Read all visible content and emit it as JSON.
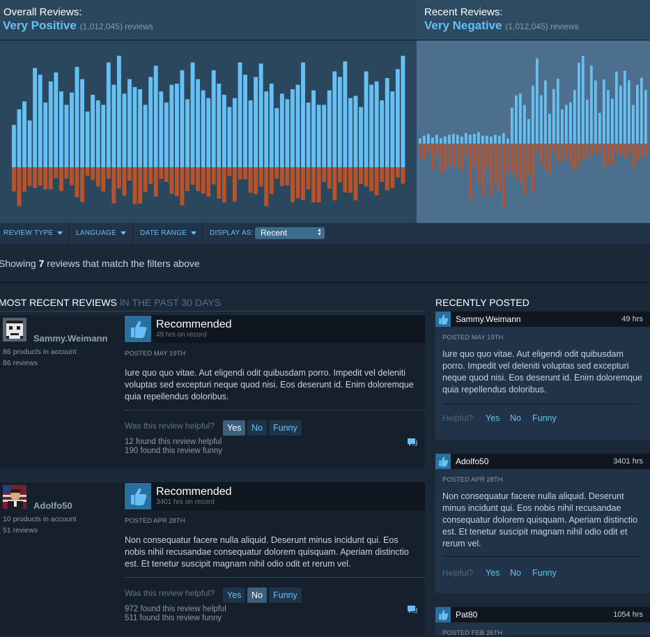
{
  "overall": {
    "label": "Overall Reviews:",
    "rating": "Very Positive",
    "count": "(1,012,045) reviews",
    "pos": [
      0.38,
      0.52,
      0.59,
      0.42,
      0.89,
      0.83,
      0.58,
      0.77,
      0.85,
      0.68,
      0.56,
      0.67,
      0.9,
      0.79,
      0.5,
      0.65,
      0.6,
      0.56,
      0.94,
      0.74,
      1.0,
      0.66,
      0.79,
      0.72,
      0.7,
      0.56,
      0.81,
      0.91,
      0.68,
      0.58,
      0.74,
      0.75,
      0.87,
      0.61,
      0.94,
      0.79,
      0.69,
      0.62,
      0.87,
      0.75,
      0.65,
      0.54,
      0.62,
      0.94,
      0.83,
      0.6,
      0.81,
      0.93,
      0.68,
      0.75,
      0.53,
      0.66,
      0.61,
      0.7,
      0.74,
      0.94,
      0.58,
      0.69,
      0.56,
      0.56,
      0.69,
      0.86,
      0.81,
      0.95,
      0.62,
      0.64,
      0.54,
      0.86,
      0.74,
      0.77,
      0.6,
      0.8,
      0.68,
      0.88,
      1.0
    ],
    "neg": [
      0.58,
      0.93,
      0.58,
      0.45,
      0.5,
      0.44,
      0.53,
      0.53,
      0.26,
      0.57,
      0.27,
      0.43,
      0.72,
      0.83,
      0.2,
      0.31,
      0.46,
      0.58,
      0.27,
      0.86,
      0.51,
      0.68,
      0.32,
      0.88,
      0.87,
      0.59,
      0.4,
      0.7,
      0.28,
      0.35,
      0.63,
      0.69,
      0.91,
      0.57,
      0.42,
      0.57,
      0.63,
      0.7,
      0.41,
      0.75,
      0.84,
      0.21,
      0.82,
      0.29,
      0.29,
      0.61,
      0.64,
      0.46,
      0.93,
      0.64,
      0.27,
      0.45,
      0.43,
      0.84,
      0.74,
      0.78,
      0.53,
      0.84,
      0.84,
      0.35,
      0.51,
      0.79,
      0.36,
      0.6,
      0.61,
      0.79,
      0.4,
      0.46,
      0.57,
      0.67,
      0.35,
      0.55,
      0.5,
      0.24,
      0.39
    ]
  },
  "recent": {
    "label": "Recent Reviews:",
    "rating": "Very Negative",
    "count": "(1,012,045) reviews",
    "pos": [
      0.06,
      0.09,
      0.11,
      0.07,
      0.1,
      0.06,
      0.08,
      0.1,
      0.11,
      0.1,
      0.08,
      0.12,
      0.1,
      0.11,
      0.13,
      0.09,
      0.09,
      0.08,
      0.1,
      0.09,
      0.12,
      0.06,
      0.41,
      0.55,
      0.57,
      0.44,
      0.28,
      0.66,
      0.97,
      0.55,
      0.72,
      0.34,
      0.62,
      0.74,
      0.39,
      0.44,
      0.47,
      0.61,
      0.92,
      1.0,
      0.5,
      0.89,
      0.72,
      0.35,
      0.73,
      0.61,
      0.51,
      0.82,
      0.66,
      0.83,
      0.72,
      0.44,
      0.67,
      0.75,
      0.61
    ],
    "neg": [
      0.23,
      0.25,
      0.15,
      0.41,
      0.19,
      0.46,
      0.41,
      0.33,
      0.37,
      0.37,
      0.43,
      0.2,
      0.88,
      0.35,
      0.63,
      0.8,
      0.4,
      0.83,
      0.65,
      0.75,
      1.0,
      0.46,
      0.46,
      0.53,
      0.61,
      0.79,
      0.48,
      0.76,
      0.14,
      0.32,
      0.43,
      0.47,
      0.14,
      0.29,
      0.27,
      0.21,
      0.34,
      0.43,
      0.34,
      0.25,
      0.22,
      0.16,
      0.19,
      0.14,
      0.36,
      0.33,
      0.35,
      0.13,
      0.18,
      0.24,
      0.17,
      0.38,
      0.28,
      0.22,
      0.19
    ]
  },
  "filters": {
    "review_type": "REVIEW TYPE",
    "language": "LANGUAGE",
    "date_range": "DATE RANGE",
    "display_as": "DISPLAY AS:",
    "display_value": "Recent"
  },
  "showing": {
    "pre": "Showing ",
    "num": "7",
    "post": " reviews that match the filters above"
  },
  "main": {
    "title": "MOST RECENT REVIEWS",
    "title_dim": " IN THE PAST 30 DAYS",
    "reviews": [
      {
        "user": "Sammy.Weimann",
        "products": "86 products in account",
        "reviews": "86 reviews",
        "verdict": "Recommended",
        "hours": "49 hrs on record",
        "posted": "POSTED MAY 19TH",
        "body": "Iure quo quo vitae. Aut eligendi odit quibusdam porro. Impedit vel deleniti voluptas sed excepturi neque quod nisi. Eos deserunt id. Enim doloremque quia repellendus doloribus.",
        "helpful_q": "Was this review helpful?",
        "yes": "Yes",
        "no": "No",
        "funny": "Funny",
        "found_helpful": "12 found this review helpful",
        "found_funny": "190 found this review funny"
      },
      {
        "user": "Adolfo50",
        "products": "10 products in account",
        "reviews": "51 reviews",
        "verdict": "Recommended",
        "hours": "3401 hrs on record",
        "posted": "POSTED APR 28TH",
        "body": "Non consequatur facere nulla aliquid. Deserunt minus incidunt qui. Eos nobis nihil recusandae consequatur dolorem quisquam. Aperiam distinctio est. Et tenetur suscipit magnam nihil odio odit et rerum vel.",
        "helpful_q": "Was this review helpful?",
        "yes": "Yes",
        "no": "No",
        "funny": "Funny",
        "found_helpful": "972 found this review helpful",
        "found_funny": "511 found this review funny"
      }
    ]
  },
  "recently_posted": {
    "title": "RECENTLY POSTED",
    "cards": [
      {
        "user": "Sammy.Weimann",
        "hours": "49 hrs",
        "posted": "POSTED MAY 19TH",
        "body": "Iure quo quo vitae. Aut eligendi odit quibusdam porro. Impedit vel deleniti voluptas sed excepturi neque quod nisi. Eos deserunt id. Enim doloremque quia repellendus doloribus.",
        "helpful": "Helpful?",
        "yes": "Yes",
        "no": "No",
        "funny": "Funny"
      },
      {
        "user": "Adolfo50",
        "hours": "3401 hrs",
        "posted": "POSTED APR 28TH",
        "body": "Non consequatur facere nulla aliquid. Deserunt minus incidunt qui. Eos nobis nihil recusandae consequatur dolorem quisquam. Aperiam distinctio est. Et tenetur suscipit magnam nihil odio odit et rerum vel.",
        "helpful": "Helpful?",
        "yes": "Yes",
        "no": "No",
        "funny": "Funny"
      },
      {
        "user": "Pat80",
        "hours": "1054 hrs",
        "posted": "POSTED FEB 26TH"
      }
    ]
  },
  "colors": {
    "positive": "#66c0f4",
    "negative": "#b8522b",
    "accent": "#66c0f4",
    "background": "#1b2838"
  },
  "icons": [
    "thumbs-up-icon",
    "caret-down-icon",
    "select-arrows-icon",
    "comment-icon",
    "avatar"
  ]
}
